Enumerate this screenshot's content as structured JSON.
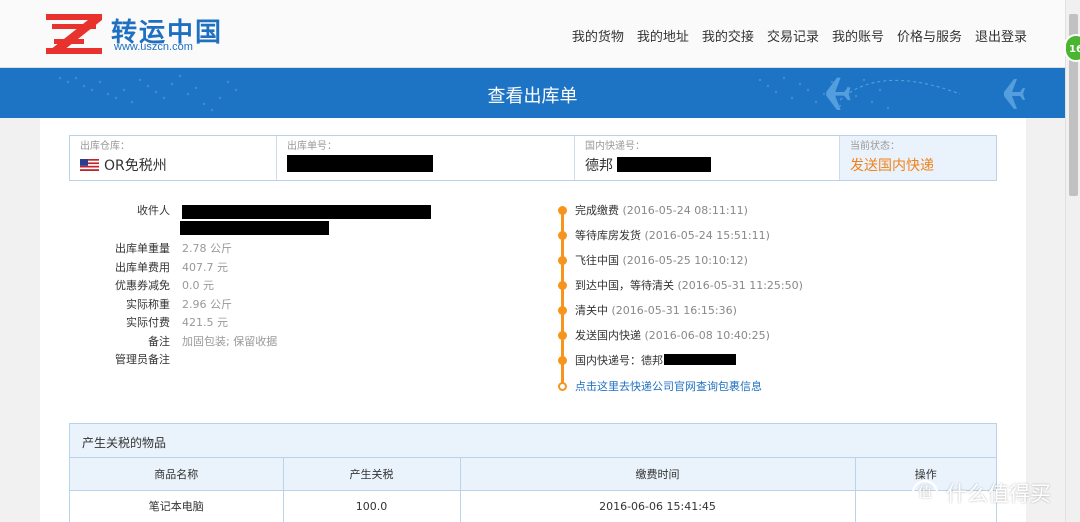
{
  "header": {
    "logo_cn": "转运中国",
    "logo_url": "www.uszcn.com",
    "nav": [
      "我的货物",
      "我的地址",
      "我的交接",
      "交易记录",
      "我的账号",
      "价格与服务",
      "退出登录"
    ]
  },
  "badge": "16",
  "banner": {
    "title": "查看出库单"
  },
  "info": {
    "warehouse_label": "出库仓库：",
    "warehouse_value": "OR免税州",
    "order_label": "出库单号：",
    "express_label": "国内快递号：",
    "express_value": "德邦",
    "status_label": "当前状态：",
    "status_value": "发送国内快递"
  },
  "details": {
    "recipient_label": "收件人",
    "weight_label": "出库单重量",
    "weight_value": "2.78 公斤",
    "fee_label": "出库单费用",
    "fee_value": "407.7 元",
    "coupon_label": "优惠券减免",
    "coupon_value": "0.0 元",
    "actual_weight_label": "实际称重",
    "actual_weight_value": "2.96 公斤",
    "paid_label": "实际付费",
    "paid_value": "421.5 元",
    "remark_label": "备注",
    "remark_value": "加固包装; 保留收据",
    "admin_remark_label": "管理员备注"
  },
  "timeline": [
    {
      "text": "完成缴费",
      "time": "(2016-05-24 08:11:11)"
    },
    {
      "text": "等待库房发货",
      "time": "(2016-05-24 15:51:11)"
    },
    {
      "text": "飞往中国",
      "time": "(2016-05-25 10:10:12)"
    },
    {
      "text": "到达中国，等待清关",
      "time": "(2016-05-31 11:25:50)"
    },
    {
      "text": "清关中",
      "time": "(2016-05-31 16:15:36)"
    },
    {
      "text": "发送国内快递",
      "time": "(2016-06-08 10:40:25)"
    },
    {
      "text": "国内快递号：德邦",
      "time": ""
    },
    {
      "text": "点击这里去快递公司官网查询包裹信息",
      "time": ""
    }
  ],
  "duty": {
    "title": "产生关税的物品",
    "columns": [
      "商品名称",
      "产生关税",
      "缴费时间",
      "操作"
    ],
    "rows": [
      [
        "笔记本电脑",
        "100.0",
        "2016-06-06 15:41:45",
        ""
      ]
    ]
  },
  "watermark": {
    "icon": "值",
    "text": "什么值得买"
  },
  "colors": {
    "brand_blue": "#1d74c4",
    "accent_orange": "#f7941d",
    "status_orange": "#f0821e"
  }
}
